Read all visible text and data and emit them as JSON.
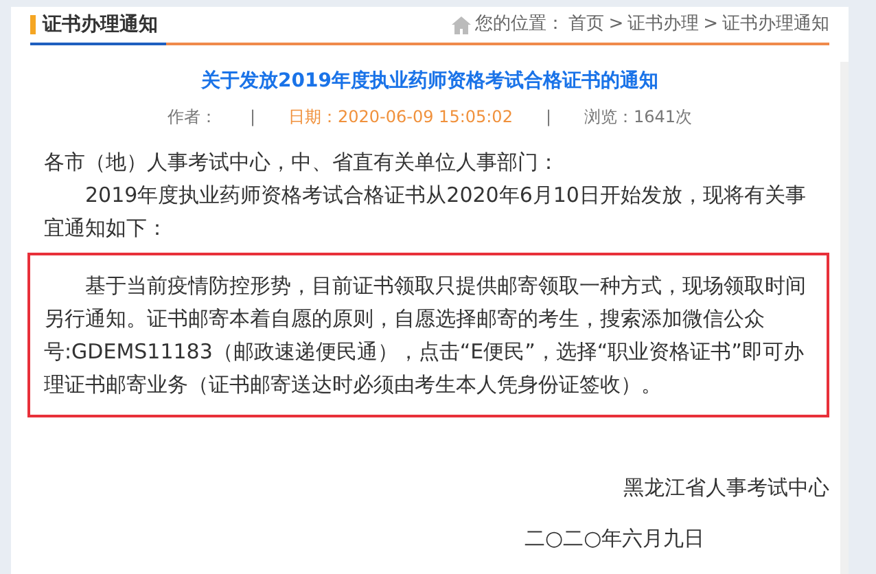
{
  "panel": {
    "title": "证书办理通知",
    "breadcrumb": {
      "label": "您的位置：",
      "items": [
        "首页",
        "证书办理",
        "证书办理通知"
      ],
      "separator": ">"
    }
  },
  "article": {
    "title": "关于发放2019年度执业药师资格考试合格证书的通知",
    "meta": {
      "author_label": "作者：",
      "date": "日期：2020-06-09 15:05:02",
      "views": "浏览：1641次",
      "divider": "|"
    },
    "paragraphs": [
      {
        "text": "各市（地）人事考试中心，中、省直有关单位人事部门：",
        "indent": false,
        "boxed": false
      },
      {
        "text": "2019年度执业药师资格考试合格证书从2020年6月10日开始发放，现将有关事宜通知如下：",
        "indent": true,
        "boxed": false
      },
      {
        "text": "基于当前疫情防控形势，目前证书领取只提供邮寄领取一种方式，现场领取时间另行通知。证书邮寄本着自愿的原则，自愿选择邮寄的考生，搜索添加微信公众号:GDEMS11183（邮政速递便民通），点击“E便民”，选择“职业资格证书”即可办理证书邮寄业务（证书邮寄送达时必须由考生本人凭身份证签收）。",
        "indent": true,
        "boxed": true
      }
    ],
    "signature": "黑龙江省人事考试中心",
    "date": "二○二○年六月九日"
  }
}
